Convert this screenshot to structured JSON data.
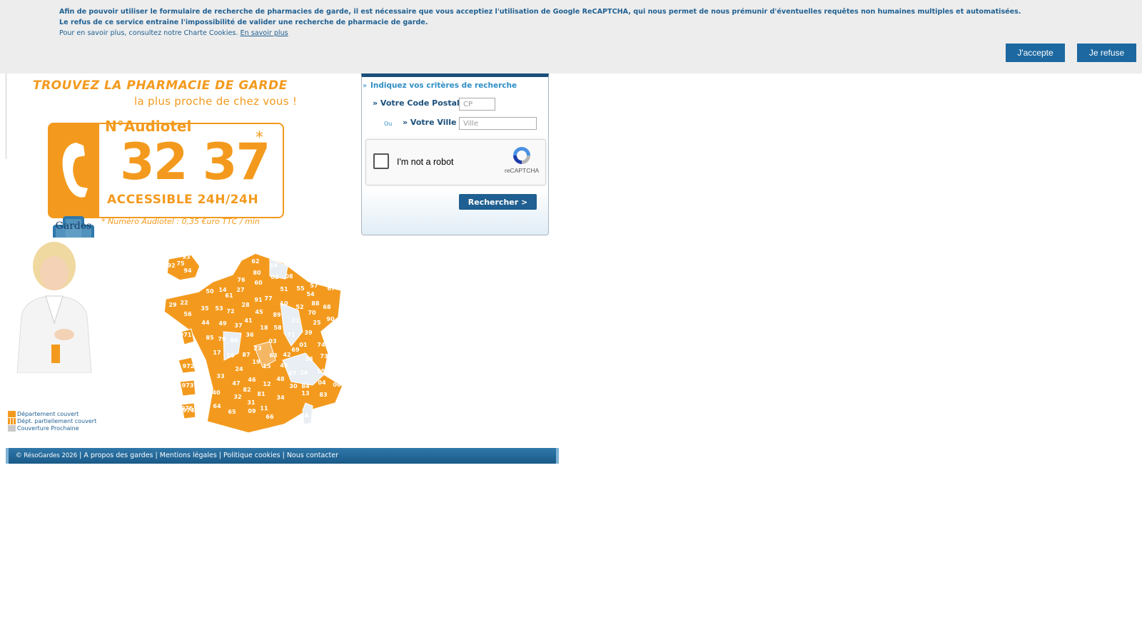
{
  "cookie_banner": {
    "line1": "Afin de pouvoir utiliser le formulaire de recherche de pharmacies de garde, il est nécessaire que vous acceptiez l'utilisation de Google ReCAPTCHA, qui nous permet de nous prémunir d'éventuelles requêtes non humaines multiples et automatisées.",
    "line2": "Le refus de ce service entraine l'impossibilité de valider une recherche de pharmacie de garde.",
    "line3": "Pour en savoir plus, consultez notre Charte Cookies.",
    "learn_more_link": "En savoir plus",
    "accept_label": "J'accepte",
    "refuse_label": "Je refuse"
  },
  "hero": {
    "headline": "TROUVEZ LA PHARMACIE DE GARDE",
    "subheadline": "la plus proche de chez vous !",
    "audiotel_title": "N°Audiotel",
    "phone_number": "32 37",
    "asterisk": "*",
    "availability": "ACCESSIBLE 24H/24H",
    "tarif_note": "* Numéro Audiotel : 0,35 €uro TTC / min",
    "gardes_logo_text": "Gardes"
  },
  "legend": {
    "items": [
      {
        "label": "Département couvert",
        "color": "#f39a1e"
      },
      {
        "label": "Dépt. partiellement couvert",
        "color": "#f6b764"
      },
      {
        "label": "Couverture Prochaine",
        "color": "#c9c9c9"
      }
    ]
  },
  "map": {
    "departments_labels": [
      "62",
      "59",
      "80",
      "02",
      "08",
      "76",
      "60",
      "27",
      "14",
      "50",
      "51",
      "55",
      "57",
      "67",
      "54",
      "88",
      "68",
      "52",
      "10",
      "70",
      "90",
      "25",
      "39",
      "21",
      "58",
      "71",
      "01",
      "74",
      "73",
      "38",
      "69",
      "42",
      "03",
      "63",
      "43",
      "07",
      "26",
      "05",
      "04",
      "06",
      "83",
      "13",
      "84",
      "30",
      "48",
      "15",
      "19",
      "87",
      "23",
      "36",
      "18",
      "41",
      "45",
      "89",
      "77",
      "91",
      "28",
      "61",
      "72",
      "53",
      "35",
      "22",
      "29",
      "56",
      "44",
      "49",
      "37",
      "86",
      "79",
      "85",
      "17",
      "16",
      "24",
      "33",
      "47",
      "40",
      "64",
      "65",
      "32",
      "82",
      "46",
      "12",
      "81",
      "31",
      "09",
      "11",
      "66",
      "34",
      "2A",
      "75",
      "92",
      "93",
      "94",
      "971",
      "972",
      "973",
      "974",
      "976"
    ]
  },
  "search_form": {
    "title": "Indiquez vos critères de recherche",
    "postal_label": "» Votre Code Postal :",
    "postal_placeholder": "CP",
    "or_label": "Ou",
    "city_label": "» Votre Ville :",
    "city_placeholder": "Ville",
    "captcha_text": "I'm not a robot",
    "captcha_brand": "reCAPTCHA",
    "search_button": "Rechercher   >"
  },
  "footer": {
    "copyright": "© RésoGardes 2026",
    "links": [
      "A propos des gardes",
      "Mentions légales",
      "Politique cookies",
      "Nous contacter"
    ]
  },
  "colors": {
    "brand_orange": "#f39a1e",
    "brand_blue": "#1f5f91",
    "banner_bg": "#ededed"
  }
}
